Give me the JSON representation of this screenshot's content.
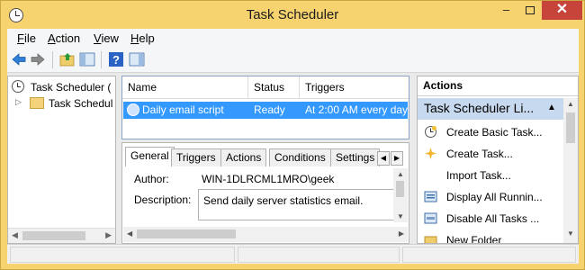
{
  "window": {
    "title": "Task Scheduler"
  },
  "menu": [
    {
      "label": "File",
      "key": "F",
      "rest": "ile"
    },
    {
      "label": "Action",
      "key": "A",
      "rest": "ction"
    },
    {
      "label": "View",
      "key": "V",
      "rest": "iew"
    },
    {
      "label": "Help",
      "key": "H",
      "rest": "elp"
    }
  ],
  "toolbar": {
    "icons": [
      "back-arrow-icon",
      "forward-arrow-icon",
      "up-folder-icon",
      "show-hide-tree-icon",
      "help-icon",
      "show-hide-action-pane-icon"
    ]
  },
  "tree": {
    "root": "Task Scheduler (",
    "child": "Task Schedul"
  },
  "tasklist": {
    "columns": [
      "Name",
      "Status",
      "Triggers"
    ],
    "rows": [
      {
        "name": "Daily email script",
        "status": "Ready",
        "triggers": "At 2:00 AM every day"
      }
    ]
  },
  "details": {
    "tabs": [
      "General",
      "Triggers",
      "Actions",
      "Conditions",
      "Settings"
    ],
    "active_tab": "General",
    "author_label": "Author:",
    "author_value": "WIN-1DLRCML1MRO\\geek",
    "description_label": "Description:",
    "description_value": "Send daily server statistics email."
  },
  "actions": {
    "header": "Actions",
    "group": "Task Scheduler Li...",
    "items": [
      {
        "label": "Create Basic Task...",
        "icon": "create-basic-task-icon"
      },
      {
        "label": "Create Task...",
        "icon": "create-task-icon"
      },
      {
        "label": "Import Task...",
        "icon": ""
      },
      {
        "label": "Display All Runnin...",
        "icon": "display-running-icon"
      },
      {
        "label": "Disable All Tasks ...",
        "icon": "disable-tasks-icon"
      },
      {
        "label": "New Folder",
        "icon": "new-folder-icon"
      }
    ]
  },
  "colors": {
    "titlebar": "#f6d36f",
    "selection": "#3399ff",
    "close_button": "#c7443b",
    "actions_group": "#c7d9ee"
  }
}
